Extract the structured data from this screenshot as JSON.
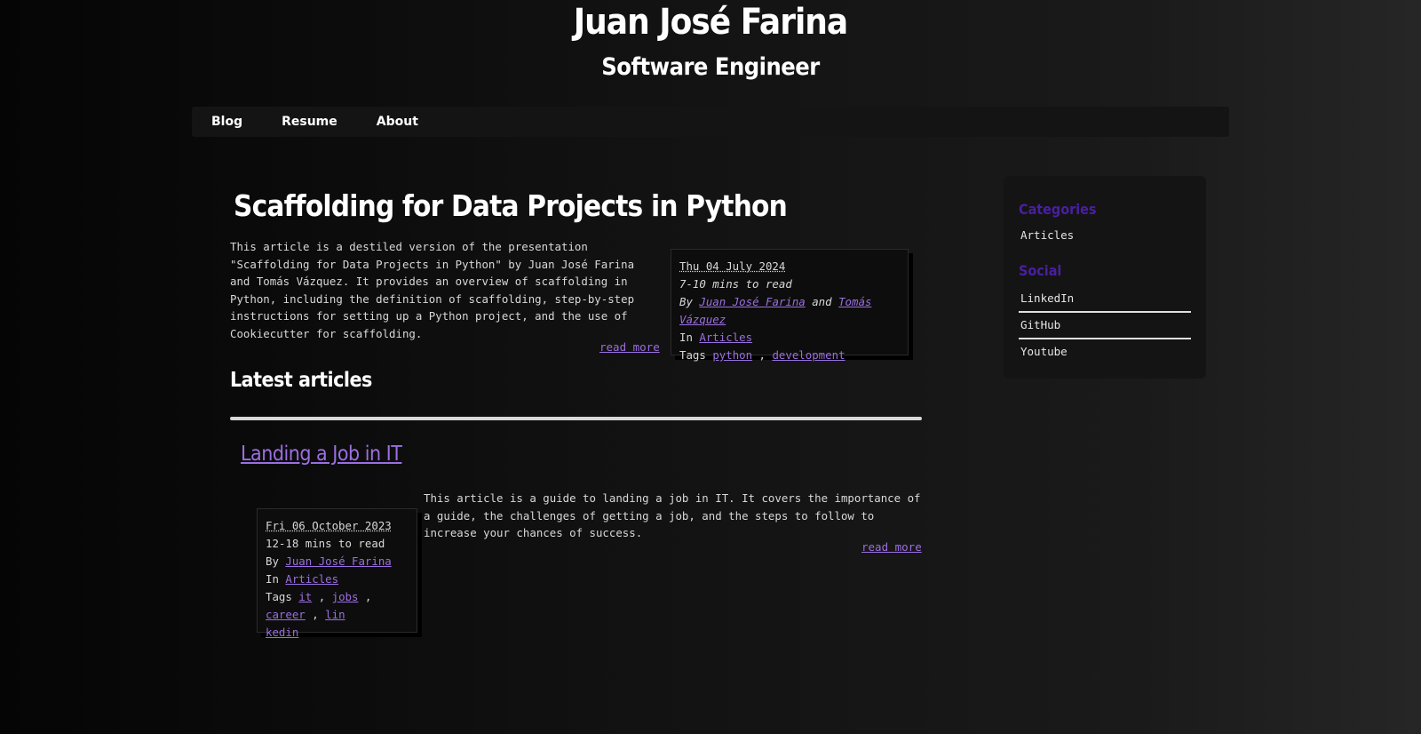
{
  "site": {
    "title": "Juan José Farina",
    "subtitle": "Software Engineer"
  },
  "nav": {
    "items": [
      "Blog",
      "Resume",
      "About"
    ]
  },
  "featured": {
    "title": "Scaffolding for Data Projects in Python",
    "summary": "This article is a destiled version of the presentation \"Scaffolding for Data Projects in Python\" by Juan José Farina and Tomás Vázquez. It provides an overview of scaffolding in Python, including the definition of scaffolding, step-by-step instructions for setting up a Python project, and the use of Cookiecutter for scaffolding.",
    "read_more": "read more",
    "meta": {
      "date": "Thu 04 July 2024",
      "read_time": "7-10 mins to read",
      "by_label": "By",
      "authors": [
        "Juan José Farina",
        "Tomás Vázquez"
      ],
      "and_label": "and",
      "in_label": "In",
      "category": "Articles",
      "tags_label": "Tags",
      "tags": [
        "python",
        "development"
      ]
    }
  },
  "latest": {
    "heading": "Latest articles",
    "articles": [
      {
        "title": "Landing a Job in IT",
        "summary": "This article is a guide to landing a job in IT. It covers the importance of a guide, the challenges of getting a job, and the steps to follow to increase your chances of success.",
        "read_more": "read more",
        "meta": {
          "date": "Fri 06 October 2023",
          "read_time": "12-18 mins to read",
          "by_label": "By",
          "author": "Juan José Farina",
          "in_label": "In",
          "category": "Articles",
          "tags_label": "Tags",
          "tags": [
            "it",
            "jobs",
            "career",
            "lin",
            "kedin"
          ]
        }
      }
    ]
  },
  "sidebar": {
    "categories_heading": "Categories",
    "categories": [
      "Articles"
    ],
    "social_heading": "Social",
    "social": [
      "LinkedIn",
      "GitHub",
      "Youtube"
    ]
  },
  "colors": {
    "link": "#9b6fe0",
    "sidebar_heading": "#4a1fa0"
  }
}
